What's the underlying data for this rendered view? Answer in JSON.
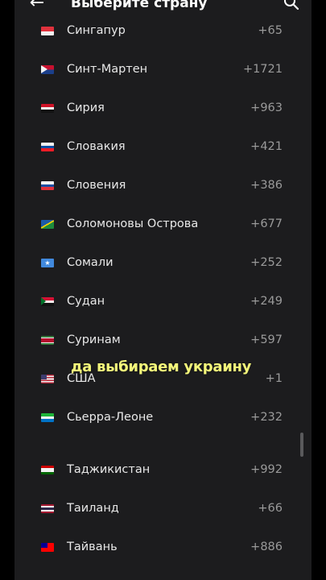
{
  "header": {
    "title": "Выберите страну",
    "back_icon": "arrow-left-icon",
    "search_icon": "search-icon"
  },
  "countries": [
    {
      "name": "Сингапур",
      "code": "+65"
    },
    {
      "name": "Синт-Мартен",
      "code": "+1721"
    },
    {
      "name": "Сирия",
      "code": "+963"
    },
    {
      "name": "Словакия",
      "code": "+421"
    },
    {
      "name": "Словения",
      "code": "+386"
    },
    {
      "name": "Соломоновы Острова",
      "code": "+677"
    },
    {
      "name": "Сомали",
      "code": "+252"
    },
    {
      "name": "Судан",
      "code": "+249"
    },
    {
      "name": "Суринам",
      "code": "+597"
    },
    {
      "name": "США",
      "code": "+1"
    },
    {
      "name": "Сьерра-Леоне",
      "code": "+232"
    },
    {
      "name": "Таджикистан",
      "code": "+992"
    },
    {
      "name": "Таиланд",
      "code": "+66"
    },
    {
      "name": "Тайвань",
      "code": "+886"
    }
  ],
  "caption": "да выбираем украину"
}
